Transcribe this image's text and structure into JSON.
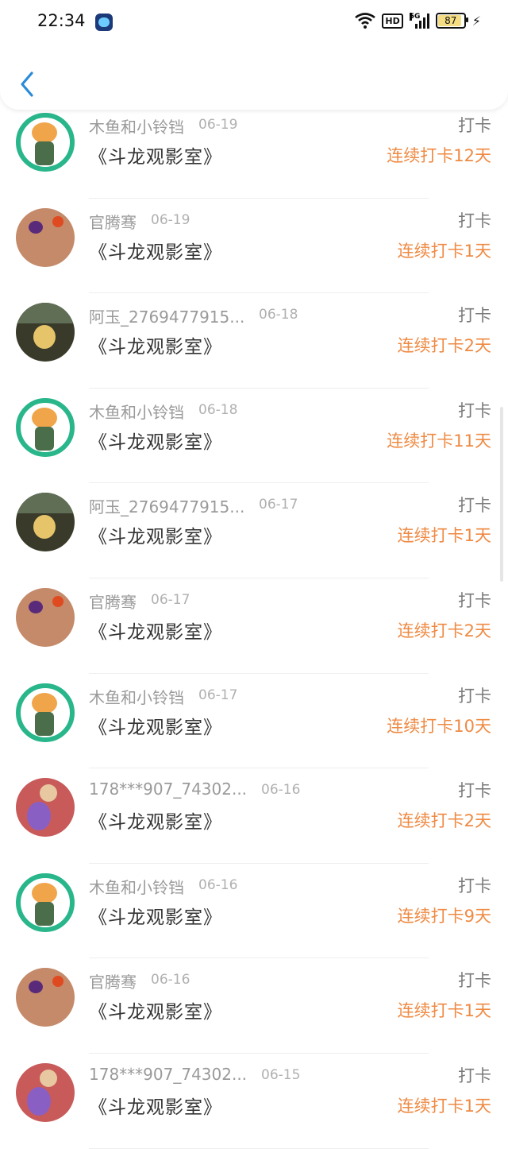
{
  "status_bar": {
    "time": "22:34",
    "hd_label": "HD",
    "network_label": "5G",
    "battery_level": "87",
    "icons": [
      "app-badge-icon",
      "wifi-icon",
      "hd-icon",
      "signal-icon",
      "battery-icon",
      "charging-icon"
    ]
  },
  "header": {
    "back_icon": "chevron-left-icon",
    "accent_color": "#2a8bd8"
  },
  "colors": {
    "streak": "#ef8a43",
    "name": "#9a9a9a",
    "title": "#333333"
  },
  "items": [
    {
      "name": "木鱼和小铃铛",
      "date": "06-19",
      "title": "《斗龙观影室》",
      "action": "打卡",
      "streak": "连续打卡12天",
      "avatar": "green"
    },
    {
      "name": "官腾骞",
      "date": "06-19",
      "title": "《斗龙观影室》",
      "action": "打卡",
      "streak": "连续打卡1天",
      "avatar": "lantern"
    },
    {
      "name": "阿玉_2769477915...",
      "date": "06-18",
      "title": "《斗龙观影室》",
      "action": "打卡",
      "streak": "连续打卡2天",
      "avatar": "woman"
    },
    {
      "name": "木鱼和小铃铛",
      "date": "06-18",
      "title": "《斗龙观影室》",
      "action": "打卡",
      "streak": "连续打卡11天",
      "avatar": "green"
    },
    {
      "name": "阿玉_2769477915...",
      "date": "06-17",
      "title": "《斗龙观影室》",
      "action": "打卡",
      "streak": "连续打卡1天",
      "avatar": "woman"
    },
    {
      "name": "官腾骞",
      "date": "06-17",
      "title": "《斗龙观影室》",
      "action": "打卡",
      "streak": "连续打卡2天",
      "avatar": "lantern"
    },
    {
      "name": "木鱼和小铃铛",
      "date": "06-17",
      "title": "《斗龙观影室》",
      "action": "打卡",
      "streak": "连续打卡10天",
      "avatar": "green"
    },
    {
      "name": "178***907_74302...",
      "date": "06-16",
      "title": "《斗龙观影室》",
      "action": "打卡",
      "streak": "连续打卡2天",
      "avatar": "anime"
    },
    {
      "name": "木鱼和小铃铛",
      "date": "06-16",
      "title": "《斗龙观影室》",
      "action": "打卡",
      "streak": "连续打卡9天",
      "avatar": "green"
    },
    {
      "name": "官腾骞",
      "date": "06-16",
      "title": "《斗龙观影室》",
      "action": "打卡",
      "streak": "连续打卡1天",
      "avatar": "lantern"
    },
    {
      "name": "178***907_74302...",
      "date": "06-15",
      "title": "《斗龙观影室》",
      "action": "打卡",
      "streak": "连续打卡1天",
      "avatar": "anime"
    }
  ]
}
